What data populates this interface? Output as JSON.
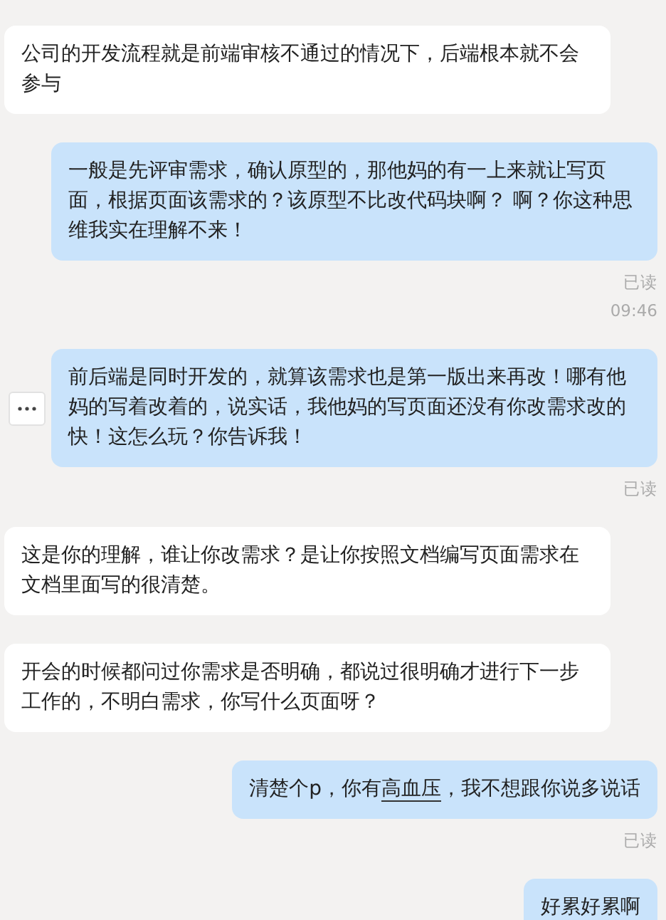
{
  "messages": [
    {
      "kind": "received",
      "parts": [
        {
          "text": "公司的开发流程就是前端审核不通过的情况下，后端根本就不会参与",
          "underlined": false
        }
      ]
    },
    {
      "kind": "sent",
      "parts": [
        {
          "text": "一般是先评审需求，确认原型的，那他妈的有一上来就让写页面，根据页面该需求的？该原型不比改代码块啊？ 啊？你这种思维我实在理解不来！",
          "underlined": false
        }
      ],
      "status": "已读",
      "time": "09:46"
    },
    {
      "kind": "sent",
      "parts": [
        {
          "text": "前后端是同时开发的，就算该需求也是第一版出来再改！哪有他妈的写着改着的，说实话，我他妈的写页面还没有你改需求改的快！这怎么玩？你告诉我！",
          "underlined": false
        }
      ],
      "status": "已读",
      "show_actions": true
    },
    {
      "kind": "received",
      "parts": [
        {
          "text": "这是你的理解，谁让你改需求？是让你按照文档编写页面需求在文档里面写的很清楚。",
          "underlined": false
        }
      ]
    },
    {
      "kind": "received",
      "parts": [
        {
          "text": "开会的时候都问过你需求是否明确，都说过很明确才进行下一步工作的，不明白需求，你写什么页面呀？",
          "underlined": false
        }
      ]
    },
    {
      "kind": "sent",
      "parts": [
        {
          "text": "清楚个p，你有",
          "underlined": false
        },
        {
          "text": "高血压",
          "underlined": true
        },
        {
          "text": "，我不想跟你说多说话",
          "underlined": false
        }
      ],
      "status": "已读"
    },
    {
      "kind": "sent",
      "parts": [
        {
          "text": "好累好累啊",
          "underlined": false
        }
      ]
    }
  ]
}
